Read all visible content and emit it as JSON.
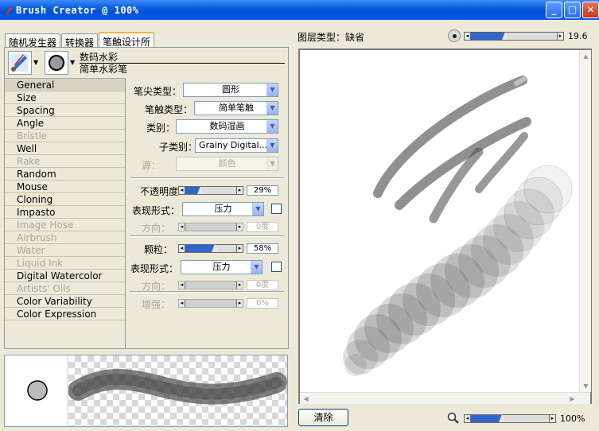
{
  "window": {
    "title": "Brush Creator @ 100%",
    "minimize_label": "_",
    "maximize_label": "□",
    "close_label": "✕"
  },
  "tabs": [
    "随机发生器",
    "转换器",
    "笔触设计所"
  ],
  "brush": {
    "category": "数码水彩",
    "variant": "简单水彩笔"
  },
  "categories": [
    {
      "label": "General",
      "enabled": true,
      "selected": true
    },
    {
      "label": "Size",
      "enabled": true
    },
    {
      "label": "Spacing",
      "enabled": true
    },
    {
      "label": "Angle",
      "enabled": true
    },
    {
      "label": "Bristle",
      "enabled": false
    },
    {
      "label": "Well",
      "enabled": true
    },
    {
      "label": "Rake",
      "enabled": false
    },
    {
      "label": "Random",
      "enabled": true
    },
    {
      "label": "Mouse",
      "enabled": true
    },
    {
      "label": "Cloning",
      "enabled": true
    },
    {
      "label": "Impasto",
      "enabled": true
    },
    {
      "label": "Image Hose",
      "enabled": false
    },
    {
      "label": "Airbrush",
      "enabled": false
    },
    {
      "label": "Water",
      "enabled": false
    },
    {
      "label": "Liquid Ink",
      "enabled": false
    },
    {
      "label": "Digital Watercolor",
      "enabled": true
    },
    {
      "label": "Artists' Oils",
      "enabled": false
    },
    {
      "label": "Color Variability",
      "enabled": true
    },
    {
      "label": "Color Expression",
      "enabled": true
    }
  ],
  "general": {
    "dab_type_label": "笔尖类型：",
    "dab_type_value": "圆形",
    "stroke_type_label": "笔触类型：",
    "stroke_type_value": "简单笔触",
    "method_label": "类别：",
    "method_value": "数码湿画",
    "subcategory_label": "子类别：",
    "subcategory_value": "Grainy Digital...",
    "source_label": "源：",
    "source_value": "颜色"
  },
  "opacity": {
    "label": "不透明度",
    "value": "29%",
    "fraction": 0.29,
    "expression_label": "表现形式：",
    "expression_value": "压力",
    "direction_label": "方向：",
    "direction_value": "0度"
  },
  "grain": {
    "label": "颗粒：",
    "value": "58%",
    "fraction": 0.58,
    "expression_label": "表现形式：",
    "expression_value": "压力",
    "direction_label": "方向：",
    "direction_value": "0度"
  },
  "boost": {
    "label": "增强：",
    "value": "0%"
  },
  "layer": {
    "label": "图层类型：",
    "value": "缺省"
  },
  "brush_size": {
    "value": "19.6",
    "fraction": 0.4
  },
  "zoom": {
    "value": "100%",
    "fraction": 0.4
  },
  "clear_button": "清除",
  "colors": {
    "title_bar": "#0050d8",
    "slider_fill": "#3366cc",
    "dialog_bg": "#ece9d8"
  }
}
